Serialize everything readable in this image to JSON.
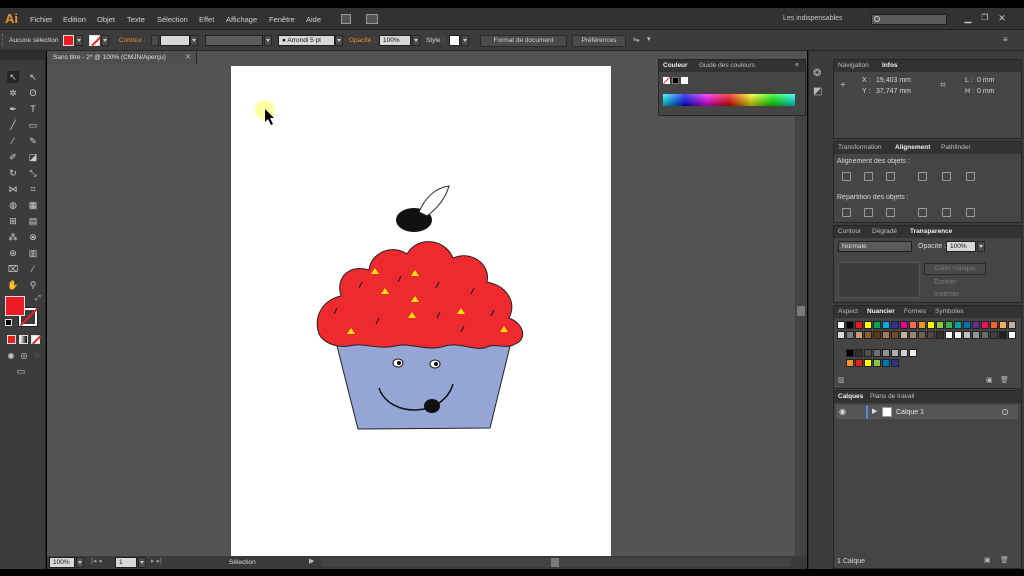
{
  "app": {
    "logo": "Ai"
  },
  "menu": [
    "Fichier",
    "Edition",
    "Objet",
    "Texte",
    "Sélection",
    "Effet",
    "Affichage",
    "Fenêtre",
    "Aide"
  ],
  "workspace": {
    "label": "Les indispensables"
  },
  "control": {
    "selection": "Aucune sélection",
    "stroke_label": "Contour :",
    "brush": "Arrondi 5 pt",
    "opacity_label": "Opacité :",
    "opacity_value": "100%",
    "style_label": "Style :",
    "doc_format": "Format de document",
    "prefs": "Préférences"
  },
  "document": {
    "tab": "Sans titre - 2* @ 100% (CMJN/Aperçu)"
  },
  "status": {
    "zoom": "100%",
    "page": "1",
    "tool": "Sélection"
  },
  "couleur": {
    "tab1": "Couleur",
    "tab2": "Guide des couleurs"
  },
  "navigation": {
    "tab1": "Navigation",
    "tab2": "Infos",
    "x_label": "X :",
    "x_value": "19,403 mm",
    "y_label": "Y :",
    "y_value": "37,747 mm",
    "l_label": "L :",
    "l_value": "0 mm",
    "h_label": "H :",
    "h_value": "0 mm"
  },
  "alignement": {
    "tab1": "Transformation",
    "tab2": "Alignement",
    "tab3": "Pathfinder",
    "align_label": "Alignement des objets :",
    "repart_label": "Répartition des objets :"
  },
  "transparence": {
    "tab1": "Contour",
    "tab2": "Dégradé",
    "tab3": "Transparence",
    "mode": "Normale",
    "opacity_label": "Opacité :",
    "opacity_value": "100%",
    "mask_btn": "Créer masque",
    "clip": "Écrêter",
    "invert": "Inverser"
  },
  "nuancier": {
    "tab1": "Aspect",
    "tab2": "Nuancier",
    "tab3": "Formes",
    "tab4": "Symboles",
    "row1": [
      "#ffffff",
      "#000000",
      "#ed1c24",
      "#ffff00",
      "#00a651",
      "#00aeef",
      "#2e3192",
      "#ec008c",
      "#f26c4f",
      "#f7941d",
      "#fff200",
      "#8dc63f",
      "#39b54a",
      "#00a99d",
      "#0072bc",
      "#662d91",
      "#ed145b",
      "#f26522",
      "#fbaf5d",
      "#c7b299"
    ],
    "row2": [
      "#d8d8d8",
      "#7d7d7d",
      "#c69c6d",
      "#8c6239",
      "#603913",
      "#a67c52",
      "#754c24",
      "#c7b299",
      "#998675",
      "#736357",
      "#534741",
      "#362f2d",
      "#ffffff",
      "#f2f2f2",
      "#c2c2c2",
      "#959595",
      "#6d6d6d",
      "#414141",
      "#231f20",
      "#ffffff"
    ],
    "row3": [
      "#000000",
      "#303030",
      "#505050",
      "#707070",
      "#909090",
      "#b0b0b0",
      "#d0d0d0",
      "#efefef"
    ],
    "row4": [
      "#f7941d",
      "#ed1c24",
      "#ffff00",
      "#8dc63f",
      "#0072bc",
      "#2e3192"
    ]
  },
  "calques": {
    "tab1": "Calques",
    "tab2": "Plans de travail",
    "layer_name": "Calque 1",
    "footer": "1 Calque"
  },
  "colors": {
    "fill": "#ed1c24",
    "accent": "#4a90d9"
  }
}
